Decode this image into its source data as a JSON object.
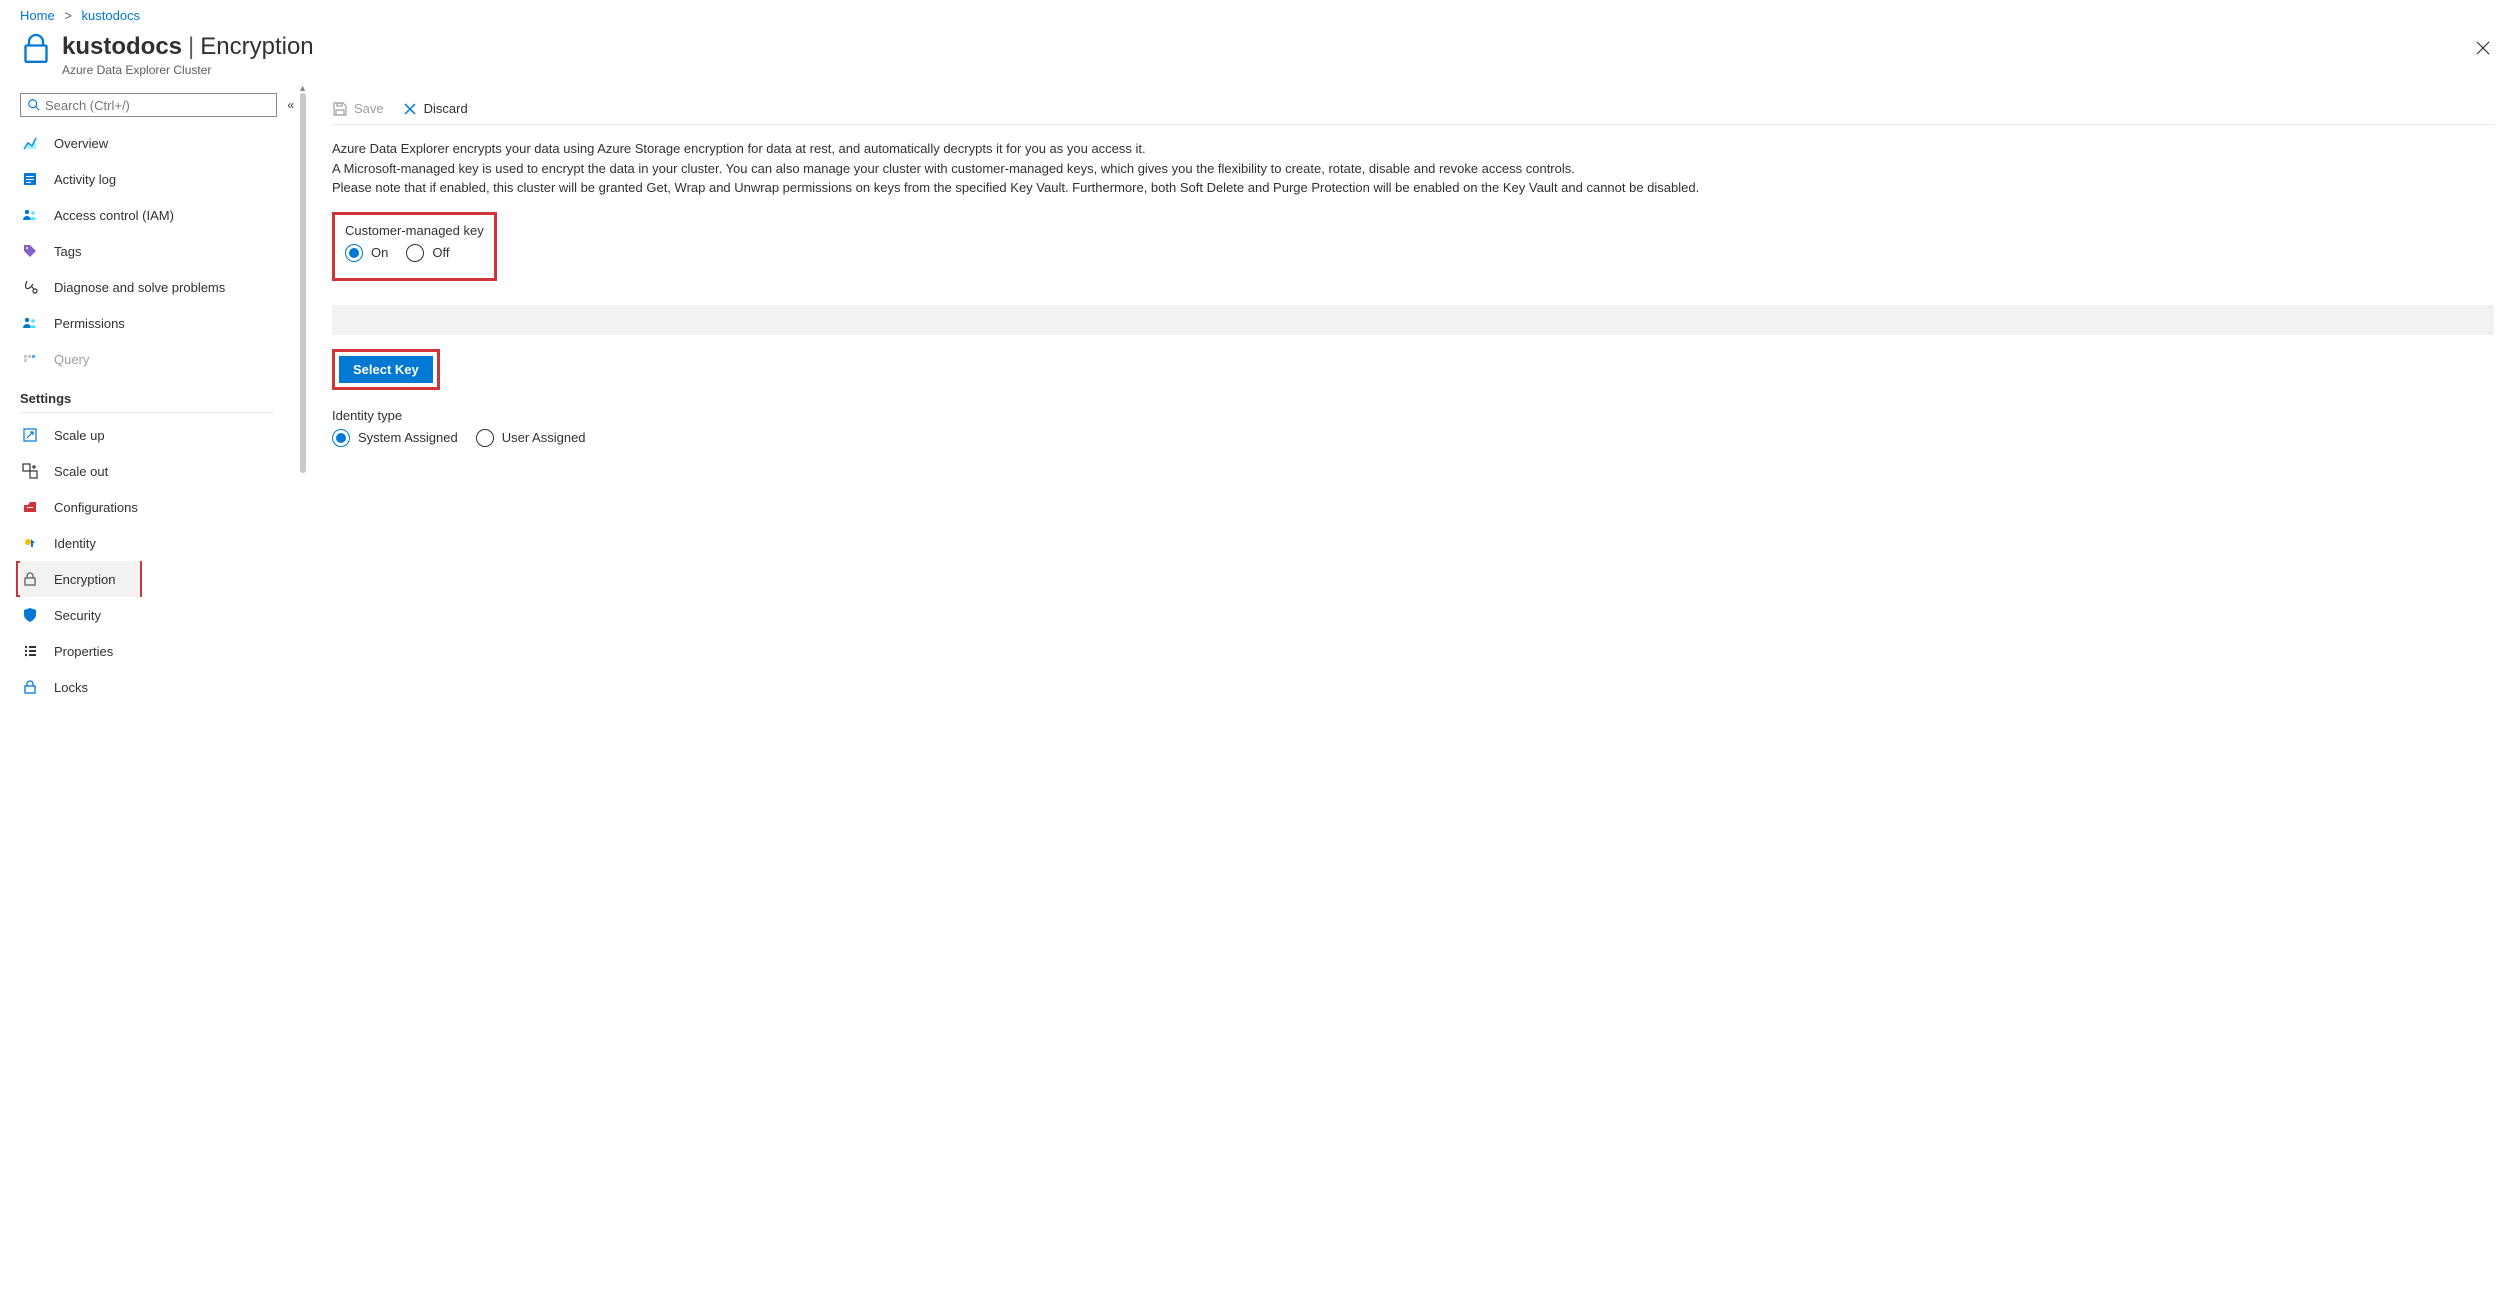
{
  "breadcrumb": {
    "home": "Home",
    "current": "kustodocs"
  },
  "header": {
    "resource": "kustodocs",
    "section": "Encryption",
    "subtitle": "Azure Data Explorer Cluster"
  },
  "search": {
    "placeholder": "Search (Ctrl+/)"
  },
  "nav_main": [
    {
      "label": "Overview"
    },
    {
      "label": "Activity log"
    },
    {
      "label": "Access control (IAM)"
    },
    {
      "label": "Tags"
    },
    {
      "label": "Diagnose and solve problems"
    },
    {
      "label": "Permissions"
    },
    {
      "label": "Query",
      "disabled": true
    }
  ],
  "settings_header": "Settings",
  "nav_settings": [
    {
      "label": "Scale up"
    },
    {
      "label": "Scale out"
    },
    {
      "label": "Configurations"
    },
    {
      "label": "Identity"
    },
    {
      "label": "Encryption",
      "active": true
    },
    {
      "label": "Security"
    },
    {
      "label": "Properties"
    },
    {
      "label": "Locks"
    }
  ],
  "toolbar": {
    "save": "Save",
    "discard": "Discard"
  },
  "description": {
    "line1": "Azure Data Explorer encrypts your data using Azure Storage encryption for data at rest, and automatically decrypts it for you as you access it.",
    "line2": "A Microsoft-managed key is used to encrypt the data in your cluster. You can also manage your cluster with customer-managed keys, which gives you the flexibility to create, rotate, disable and revoke access controls.",
    "line3": "Please note that if enabled, this cluster will be granted Get, Wrap and Unwrap permissions on keys from the specified Key Vault. Furthermore, both Soft Delete and Purge Protection will be enabled on the Key Vault and cannot be disabled."
  },
  "cmk": {
    "label": "Customer-managed key",
    "on": "On",
    "off": "Off"
  },
  "select_key": "Select Key",
  "identity": {
    "label": "Identity type",
    "system": "System Assigned",
    "user": "User Assigned"
  }
}
